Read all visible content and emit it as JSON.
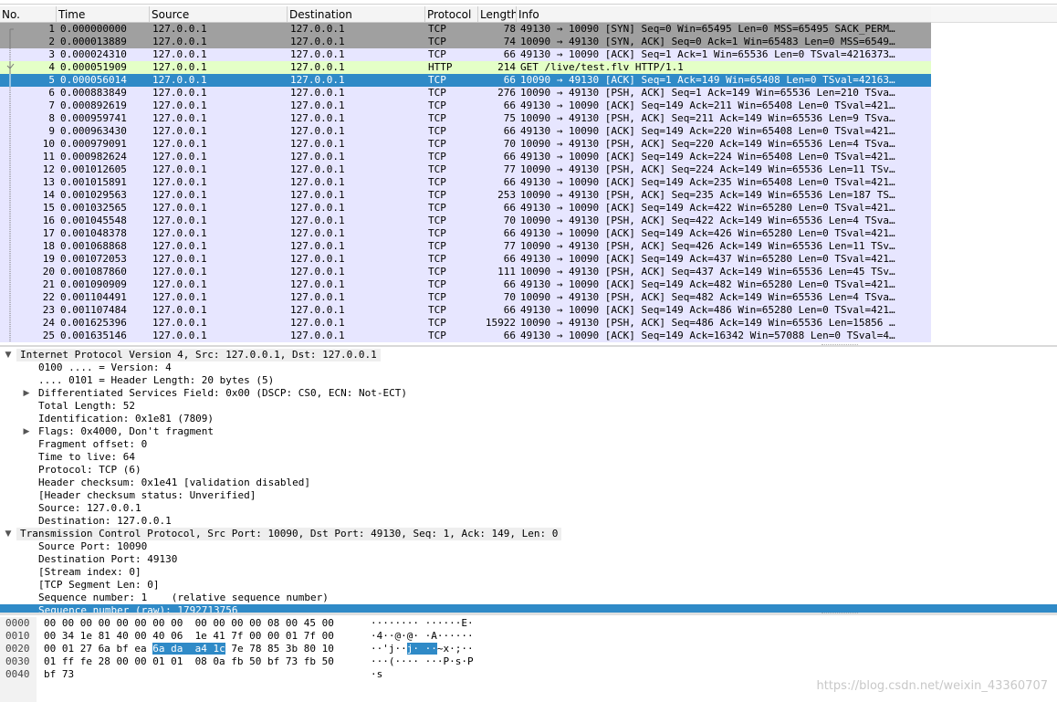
{
  "columns": {
    "no": "No.",
    "time": "Time",
    "source": "Source",
    "destination": "Destination",
    "protocol": "Protocol",
    "length": "Length",
    "info": "Info"
  },
  "colors": {
    "syn_row": "#a0a0a0",
    "tcp_row": "#e7e6ff",
    "http_row": "#e4ffc7",
    "selected": "#2f8ac7"
  },
  "packets": [
    {
      "no": "1",
      "time": "0.000000000",
      "src": "127.0.0.1",
      "dst": "127.0.0.1",
      "proto": "TCP",
      "len": "78",
      "info": "49130 → 10090 [SYN] Seq=0 Win=65495 Len=0 MSS=65495 SACK_PERM…",
      "kind": "syn"
    },
    {
      "no": "2",
      "time": "0.000013889",
      "src": "127.0.0.1",
      "dst": "127.0.0.1",
      "proto": "TCP",
      "len": "74",
      "info": "10090 → 49130 [SYN, ACK] Seq=0 Ack=1 Win=65483 Len=0 MSS=6549…",
      "kind": "syn"
    },
    {
      "no": "3",
      "time": "0.000024310",
      "src": "127.0.0.1",
      "dst": "127.0.0.1",
      "proto": "TCP",
      "len": "66",
      "info": "49130 → 10090 [ACK] Seq=1 Ack=1 Win=65536 Len=0 TSval=4216373…",
      "kind": "tcp"
    },
    {
      "no": "4",
      "time": "0.000051909",
      "src": "127.0.0.1",
      "dst": "127.0.0.1",
      "proto": "HTTP",
      "len": "214",
      "info": "GET /live/test.flv HTTP/1.1",
      "kind": "http"
    },
    {
      "no": "5",
      "time": "0.000056014",
      "src": "127.0.0.1",
      "dst": "127.0.0.1",
      "proto": "TCP",
      "len": "66",
      "info": "10090 → 49130 [ACK] Seq=1 Ack=149 Win=65408 Len=0 TSval=42163…",
      "kind": "selected"
    },
    {
      "no": "6",
      "time": "0.000883849",
      "src": "127.0.0.1",
      "dst": "127.0.0.1",
      "proto": "TCP",
      "len": "276",
      "info": "10090 → 49130 [PSH, ACK] Seq=1 Ack=149 Win=65536 Len=210 TSva…",
      "kind": "tcp"
    },
    {
      "no": "7",
      "time": "0.000892619",
      "src": "127.0.0.1",
      "dst": "127.0.0.1",
      "proto": "TCP",
      "len": "66",
      "info": "49130 → 10090 [ACK] Seq=149 Ack=211 Win=65408 Len=0 TSval=421…",
      "kind": "tcp"
    },
    {
      "no": "8",
      "time": "0.000959741",
      "src": "127.0.0.1",
      "dst": "127.0.0.1",
      "proto": "TCP",
      "len": "75",
      "info": "10090 → 49130 [PSH, ACK] Seq=211 Ack=149 Win=65536 Len=9 TSva…",
      "kind": "tcp"
    },
    {
      "no": "9",
      "time": "0.000963430",
      "src": "127.0.0.1",
      "dst": "127.0.0.1",
      "proto": "TCP",
      "len": "66",
      "info": "49130 → 10090 [ACK] Seq=149 Ack=220 Win=65408 Len=0 TSval=421…",
      "kind": "tcp"
    },
    {
      "no": "10",
      "time": "0.000979091",
      "src": "127.0.0.1",
      "dst": "127.0.0.1",
      "proto": "TCP",
      "len": "70",
      "info": "10090 → 49130 [PSH, ACK] Seq=220 Ack=149 Win=65536 Len=4 TSva…",
      "kind": "tcp"
    },
    {
      "no": "11",
      "time": "0.000982624",
      "src": "127.0.0.1",
      "dst": "127.0.0.1",
      "proto": "TCP",
      "len": "66",
      "info": "49130 → 10090 [ACK] Seq=149 Ack=224 Win=65408 Len=0 TSval=421…",
      "kind": "tcp"
    },
    {
      "no": "12",
      "time": "0.001012605",
      "src": "127.0.0.1",
      "dst": "127.0.0.1",
      "proto": "TCP",
      "len": "77",
      "info": "10090 → 49130 [PSH, ACK] Seq=224 Ack=149 Win=65536 Len=11 TSv…",
      "kind": "tcp"
    },
    {
      "no": "13",
      "time": "0.001015891",
      "src": "127.0.0.1",
      "dst": "127.0.0.1",
      "proto": "TCP",
      "len": "66",
      "info": "49130 → 10090 [ACK] Seq=149 Ack=235 Win=65408 Len=0 TSval=421…",
      "kind": "tcp"
    },
    {
      "no": "14",
      "time": "0.001029563",
      "src": "127.0.0.1",
      "dst": "127.0.0.1",
      "proto": "TCP",
      "len": "253",
      "info": "10090 → 49130 [PSH, ACK] Seq=235 Ack=149 Win=65536 Len=187 TS…",
      "kind": "tcp"
    },
    {
      "no": "15",
      "time": "0.001032565",
      "src": "127.0.0.1",
      "dst": "127.0.0.1",
      "proto": "TCP",
      "len": "66",
      "info": "49130 → 10090 [ACK] Seq=149 Ack=422 Win=65280 Len=0 TSval=421…",
      "kind": "tcp"
    },
    {
      "no": "16",
      "time": "0.001045548",
      "src": "127.0.0.1",
      "dst": "127.0.0.1",
      "proto": "TCP",
      "len": "70",
      "info": "10090 → 49130 [PSH, ACK] Seq=422 Ack=149 Win=65536 Len=4 TSva…",
      "kind": "tcp"
    },
    {
      "no": "17",
      "time": "0.001048378",
      "src": "127.0.0.1",
      "dst": "127.0.0.1",
      "proto": "TCP",
      "len": "66",
      "info": "49130 → 10090 [ACK] Seq=149 Ack=426 Win=65280 Len=0 TSval=421…",
      "kind": "tcp"
    },
    {
      "no": "18",
      "time": "0.001068868",
      "src": "127.0.0.1",
      "dst": "127.0.0.1",
      "proto": "TCP",
      "len": "77",
      "info": "10090 → 49130 [PSH, ACK] Seq=426 Ack=149 Win=65536 Len=11 TSv…",
      "kind": "tcp"
    },
    {
      "no": "19",
      "time": "0.001072053",
      "src": "127.0.0.1",
      "dst": "127.0.0.1",
      "proto": "TCP",
      "len": "66",
      "info": "49130 → 10090 [ACK] Seq=149 Ack=437 Win=65280 Len=0 TSval=421…",
      "kind": "tcp"
    },
    {
      "no": "20",
      "time": "0.001087860",
      "src": "127.0.0.1",
      "dst": "127.0.0.1",
      "proto": "TCP",
      "len": "111",
      "info": "10090 → 49130 [PSH, ACK] Seq=437 Ack=149 Win=65536 Len=45 TSv…",
      "kind": "tcp"
    },
    {
      "no": "21",
      "time": "0.001090909",
      "src": "127.0.0.1",
      "dst": "127.0.0.1",
      "proto": "TCP",
      "len": "66",
      "info": "49130 → 10090 [ACK] Seq=149 Ack=482 Win=65280 Len=0 TSval=421…",
      "kind": "tcp"
    },
    {
      "no": "22",
      "time": "0.001104491",
      "src": "127.0.0.1",
      "dst": "127.0.0.1",
      "proto": "TCP",
      "len": "70",
      "info": "10090 → 49130 [PSH, ACK] Seq=482 Ack=149 Win=65536 Len=4 TSva…",
      "kind": "tcp"
    },
    {
      "no": "23",
      "time": "0.001107484",
      "src": "127.0.0.1",
      "dst": "127.0.0.1",
      "proto": "TCP",
      "len": "66",
      "info": "49130 → 10090 [ACK] Seq=149 Ack=486 Win=65280 Len=0 TSval=421…",
      "kind": "tcp"
    },
    {
      "no": "24",
      "time": "0.001625396",
      "src": "127.0.0.1",
      "dst": "127.0.0.1",
      "proto": "TCP",
      "len": "15922",
      "info": "10090 → 49130 [PSH, ACK] Seq=486 Ack=149 Win=65536 Len=15856 …",
      "kind": "tcp"
    },
    {
      "no": "25",
      "time": "0.001635146",
      "src": "127.0.0.1",
      "dst": "127.0.0.1",
      "proto": "TCP",
      "len": "66",
      "info": "49130 → 10090 [ACK] Seq=149 Ack=16342 Win=57088 Len=0 TSval=4…",
      "kind": "tcp"
    }
  ],
  "details": [
    {
      "text": "Internet Protocol Version 4, Src: 127.0.0.1, Dst: 127.0.0.1",
      "level": 0,
      "arrow": "down",
      "header": true
    },
    {
      "text": "0100 .... = Version: 4",
      "level": 1
    },
    {
      "text": ".... 0101 = Header Length: 20 bytes (5)",
      "level": 1
    },
    {
      "text": "Differentiated Services Field: 0x00 (DSCP: CS0, ECN: Not-ECT)",
      "level": 1,
      "arrow": "right"
    },
    {
      "text": "Total Length: 52",
      "level": 1
    },
    {
      "text": "Identification: 0x1e81 (7809)",
      "level": 1
    },
    {
      "text": "Flags: 0x4000, Don't fragment",
      "level": 1,
      "arrow": "right"
    },
    {
      "text": "Fragment offset: 0",
      "level": 1
    },
    {
      "text": "Time to live: 64",
      "level": 1
    },
    {
      "text": "Protocol: TCP (6)",
      "level": 1
    },
    {
      "text": "Header checksum: 0x1e41 [validation disabled]",
      "level": 1
    },
    {
      "text": "[Header checksum status: Unverified]",
      "level": 1
    },
    {
      "text": "Source: 127.0.0.1",
      "level": 1
    },
    {
      "text": "Destination: 127.0.0.1",
      "level": 1
    },
    {
      "text": "Transmission Control Protocol, Src Port: 10090, Dst Port: 49130, Seq: 1, Ack: 149, Len: 0",
      "level": 0,
      "arrow": "down",
      "header": true
    },
    {
      "text": "Source Port: 10090",
      "level": 1
    },
    {
      "text": "Destination Port: 49130",
      "level": 1
    },
    {
      "text": "[Stream index: 0]",
      "level": 1
    },
    {
      "text": "[TCP Segment Len: 0]",
      "level": 1
    },
    {
      "text": "Sequence number: 1    (relative sequence number)",
      "level": 1
    },
    {
      "text": "Sequence number (raw): 1792713756",
      "level": 1,
      "selected": true
    }
  ],
  "bytes": [
    {
      "offset": "0000",
      "hex_pre": "00 00 00 00 00 00 00 00  00 00 00 00 08 00 45 00",
      "hex_hl": "",
      "hex_post": "",
      "ascii_pre": "········ ······E·",
      "ascii_hl": "",
      "ascii_post": ""
    },
    {
      "offset": "0010",
      "hex_pre": "00 34 1e 81 40 00 40 06  1e 41 7f 00 00 01 7f 00",
      "hex_hl": "",
      "hex_post": "",
      "ascii_pre": "·4··@·@· ·A······",
      "ascii_hl": "",
      "ascii_post": ""
    },
    {
      "offset": "0020",
      "hex_pre": "00 01 27 6a bf ea ",
      "hex_hl": "6a da  a4 1c",
      "hex_post": " 7e 78 85 3b 80 10",
      "ascii_pre": "··'j··",
      "ascii_hl": "j· ··",
      "ascii_post": "~x·;··"
    },
    {
      "offset": "0030",
      "hex_pre": "01 ff fe 28 00 00 01 01  08 0a fb 50 bf 73 fb 50",
      "hex_hl": "",
      "hex_post": "",
      "ascii_pre": "···(···· ···P·s·P",
      "ascii_hl": "",
      "ascii_post": ""
    },
    {
      "offset": "0040",
      "hex_pre": "bf 73",
      "hex_hl": "",
      "hex_post": "",
      "ascii_pre": "·s",
      "ascii_hl": "",
      "ascii_post": ""
    }
  ],
  "watermark": "https://blog.csdn.net/weixin_43360707"
}
